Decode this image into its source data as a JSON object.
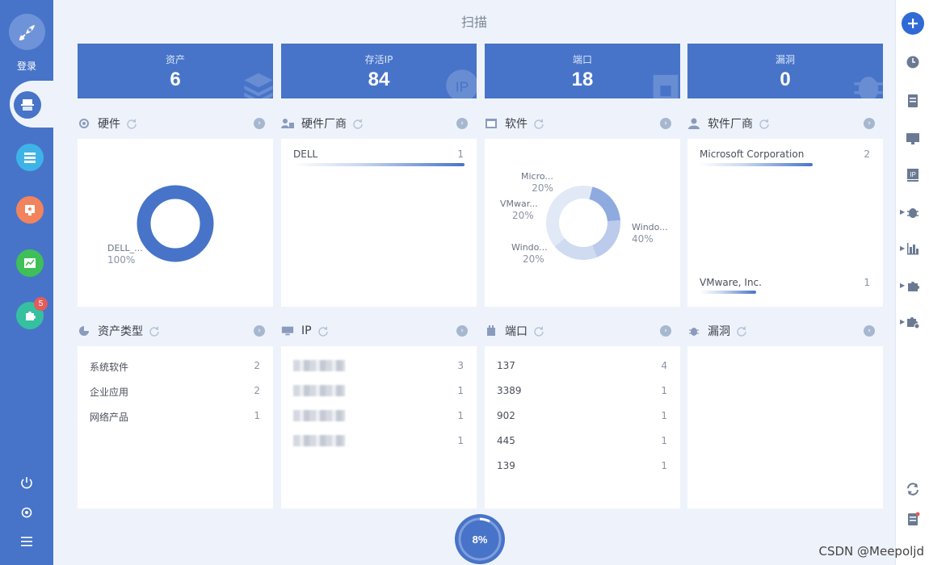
{
  "sidebar": {
    "login_label": "登录",
    "badge_count": "5",
    "nav": [
      {
        "name": "server-icon",
        "color": "#3eb3e8"
      },
      {
        "name": "report-icon",
        "color": "#f2845d"
      },
      {
        "name": "chart-icon",
        "color": "#3fbf58"
      },
      {
        "name": "plugin-icon",
        "color": "#36c0a0"
      }
    ]
  },
  "page": {
    "title": "扫描"
  },
  "stats": [
    {
      "label": "资产",
      "value": "6"
    },
    {
      "label": "存活IP",
      "value": "84"
    },
    {
      "label": "端口",
      "value": "18"
    },
    {
      "label": "漏洞",
      "value": "0"
    }
  ],
  "panels": {
    "hardware": {
      "title": "硬件",
      "chart_label": "DELL_...",
      "chart_pct": "100%"
    },
    "hw_vendor": {
      "title": "硬件厂商",
      "items": [
        {
          "label": "DELL",
          "count": "1",
          "frac": 1.0
        }
      ]
    },
    "software": {
      "title": "软件",
      "slices": [
        {
          "label": "Micro...",
          "pct": "20%"
        },
        {
          "label": "VMwar...",
          "pct": "20%"
        },
        {
          "label": "Windo...",
          "pct": "20%"
        },
        {
          "label": "Windo...",
          "pct": "40%"
        }
      ]
    },
    "sw_vendor": {
      "title": "软件厂商",
      "items": [
        {
          "label": "Microsoft Corporation",
          "count": "2",
          "frac": 1.0
        },
        {
          "label": "VMware, Inc.",
          "count": "1",
          "frac": 0.5
        }
      ]
    },
    "asset_type": {
      "title": "资产类型",
      "items": [
        {
          "label": "系统软件",
          "count": "2"
        },
        {
          "label": "企业应用",
          "count": "2"
        },
        {
          "label": "网络产品",
          "count": "1"
        }
      ]
    },
    "ip": {
      "title": "IP",
      "counts": [
        "3",
        "1",
        "1",
        "1"
      ]
    },
    "port": {
      "title": "端口",
      "items": [
        {
          "label": "137",
          "count": "4"
        },
        {
          "label": "3389",
          "count": "1"
        },
        {
          "label": "902",
          "count": "1"
        },
        {
          "label": "445",
          "count": "1"
        },
        {
          "label": "139",
          "count": "1"
        }
      ]
    },
    "vuln": {
      "title": "漏洞"
    }
  },
  "progress": {
    "label": "8%",
    "value": 0.08
  },
  "watermark": "CSDN @Meepoljd",
  "colors": {
    "primary": "#4774c9",
    "accent": "#2f6ad6"
  }
}
